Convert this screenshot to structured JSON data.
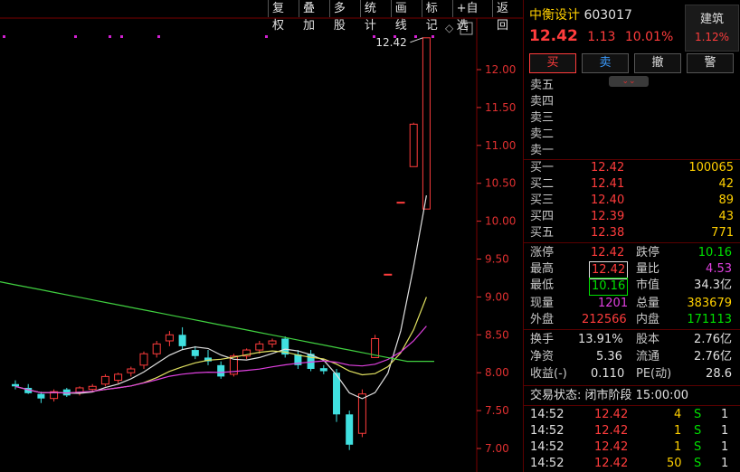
{
  "toolbar": [
    "复权",
    "叠加",
    "多股",
    "统计",
    "画线",
    "标记",
    "+自选",
    "返回"
  ],
  "chart": {
    "max_label": "12.42",
    "y_ticks": [
      "12.00",
      "11.50",
      "11.00",
      "10.50",
      "10.00",
      "9.50",
      "9.00",
      "8.50",
      "8.00",
      "7.50",
      "7.00"
    ],
    "y_values": [
      12.0,
      11.5,
      11.0,
      10.5,
      10.0,
      9.5,
      9.0,
      8.5,
      8.0,
      7.5,
      7.0
    ],
    "colors": {
      "up": "#ff3c3c",
      "down": "#40e0e0",
      "ma_white": "#e0e0e0",
      "ma_yellow": "#e0e060",
      "ma_magenta": "#e040e0",
      "ma_green": "#40d040",
      "axis": "#e03030"
    }
  },
  "chart_data": {
    "type": "candlestick",
    "y_ticks": [
      12.0,
      11.5,
      11.0,
      10.5,
      10.0,
      9.5,
      9.0,
      8.5,
      8.0,
      7.5,
      7.0
    ],
    "candles": [
      {
        "o": 7.85,
        "h": 7.9,
        "l": 7.78,
        "c": 7.82
      },
      {
        "o": 7.8,
        "h": 7.85,
        "l": 7.72,
        "c": 7.73
      },
      {
        "o": 7.72,
        "h": 7.75,
        "l": 7.6,
        "c": 7.66
      },
      {
        "o": 7.66,
        "h": 7.78,
        "l": 7.62,
        "c": 7.75
      },
      {
        "o": 7.78,
        "h": 7.8,
        "l": 7.68,
        "c": 7.7
      },
      {
        "o": 7.74,
        "h": 7.82,
        "l": 7.7,
        "c": 7.8
      },
      {
        "o": 7.78,
        "h": 7.85,
        "l": 7.74,
        "c": 7.82
      },
      {
        "o": 7.85,
        "h": 7.98,
        "l": 7.82,
        "c": 7.95
      },
      {
        "o": 7.9,
        "h": 8.0,
        "l": 7.86,
        "c": 7.98
      },
      {
        "o": 8.0,
        "h": 8.08,
        "l": 7.95,
        "c": 8.05
      },
      {
        "o": 8.1,
        "h": 8.28,
        "l": 8.05,
        "c": 8.25
      },
      {
        "o": 8.25,
        "h": 8.42,
        "l": 8.2,
        "c": 8.38
      },
      {
        "o": 8.42,
        "h": 8.55,
        "l": 8.35,
        "c": 8.5
      },
      {
        "o": 8.5,
        "h": 8.6,
        "l": 8.3,
        "c": 8.35
      },
      {
        "o": 8.3,
        "h": 8.35,
        "l": 8.18,
        "c": 8.22
      },
      {
        "o": 8.2,
        "h": 8.3,
        "l": 8.1,
        "c": 8.15
      },
      {
        "o": 8.1,
        "h": 8.15,
        "l": 7.92,
        "c": 7.95
      },
      {
        "o": 7.98,
        "h": 8.25,
        "l": 7.95,
        "c": 8.22
      },
      {
        "o": 8.22,
        "h": 8.32,
        "l": 8.18,
        "c": 8.3
      },
      {
        "o": 8.3,
        "h": 8.42,
        "l": 8.25,
        "c": 8.38
      },
      {
        "o": 8.38,
        "h": 8.45,
        "l": 8.33,
        "c": 8.42
      },
      {
        "o": 8.45,
        "h": 8.48,
        "l": 8.2,
        "c": 8.24
      },
      {
        "o": 8.24,
        "h": 8.3,
        "l": 8.05,
        "c": 8.1
      },
      {
        "o": 8.25,
        "h": 8.3,
        "l": 8.02,
        "c": 8.05
      },
      {
        "o": 8.06,
        "h": 8.1,
        "l": 7.98,
        "c": 8.02
      },
      {
        "o": 8.0,
        "h": 8.05,
        "l": 7.35,
        "c": 7.45
      },
      {
        "o": 7.45,
        "h": 7.5,
        "l": 6.98,
        "c": 7.05
      },
      {
        "o": 7.2,
        "h": 7.78,
        "l": 7.15,
        "c": 7.72
      },
      {
        "o": 8.2,
        "h": 8.5,
        "l": 8.2,
        "c": 8.45
      },
      {
        "o": 9.3,
        "h": 9.3,
        "l": 9.3,
        "c": 9.3
      },
      {
        "o": 10.25,
        "h": 10.25,
        "l": 10.25,
        "c": 10.25
      },
      {
        "o": 10.72,
        "h": 11.3,
        "l": 10.72,
        "c": 11.28
      },
      {
        "o": 10.16,
        "h": 12.42,
        "l": 10.16,
        "c": 12.42
      }
    ]
  },
  "panel": {
    "name": "中衡设计",
    "code": "603017",
    "price": "12.42",
    "change": "1.13",
    "pct": "10.01%",
    "sector": "建筑",
    "sector_pct": "1.12%",
    "buttons": [
      "买",
      "卖",
      "撤",
      "警"
    ],
    "asks": [
      {
        "label": "卖五",
        "price": "",
        "vol": ""
      },
      {
        "label": "卖四",
        "price": "",
        "vol": ""
      },
      {
        "label": "卖三",
        "price": "",
        "vol": ""
      },
      {
        "label": "卖二",
        "price": "",
        "vol": ""
      },
      {
        "label": "卖一",
        "price": "",
        "vol": ""
      }
    ],
    "bids": [
      {
        "label": "买一",
        "price": "12.42",
        "vol": "100065"
      },
      {
        "label": "买二",
        "price": "12.41",
        "vol": "42"
      },
      {
        "label": "买三",
        "price": "12.40",
        "vol": "89"
      },
      {
        "label": "买四",
        "price": "12.39",
        "vol": "43"
      },
      {
        "label": "买五",
        "price": "12.38",
        "vol": "771"
      }
    ],
    "stats": {
      "limit_up_label": "涨停",
      "limit_up": "12.42",
      "limit_down_label": "跌停",
      "limit_down": "10.16",
      "high_label": "最高",
      "high": "12.42",
      "ratio_label": "量比",
      "ratio": "4.53",
      "low_label": "最低",
      "low": "10.16",
      "mcap_label": "市值",
      "mcap": "34.3亿",
      "cur_label": "现量",
      "cur": "1201",
      "total_label": "总量",
      "total": "383679",
      "outer_label": "外盘",
      "outer": "212566",
      "inner_label": "内盘",
      "inner": "171113"
    },
    "fund": {
      "turnover_label": "换手",
      "turnover": "13.91%",
      "equity_label": "股本",
      "equity": "2.76亿",
      "nav_label": "净资",
      "nav": "5.36",
      "float_label": "流通",
      "float": "2.76亿",
      "eps_label": "收益(-)",
      "eps": "0.110",
      "pe_label": "PE(动)",
      "pe": "28.6"
    },
    "status": "交易状态: 闭市阶段 15:00:00",
    "ticks": [
      {
        "time": "14:52",
        "price": "12.42",
        "vol": "4",
        "dir": "S",
        "n": "1"
      },
      {
        "time": "14:52",
        "price": "12.42",
        "vol": "1",
        "dir": "S",
        "n": "1"
      },
      {
        "time": "14:52",
        "price": "12.42",
        "vol": "1",
        "dir": "S",
        "n": "1"
      },
      {
        "time": "14:52",
        "price": "12.42",
        "vol": "50",
        "dir": "S",
        "n": "1"
      }
    ]
  }
}
